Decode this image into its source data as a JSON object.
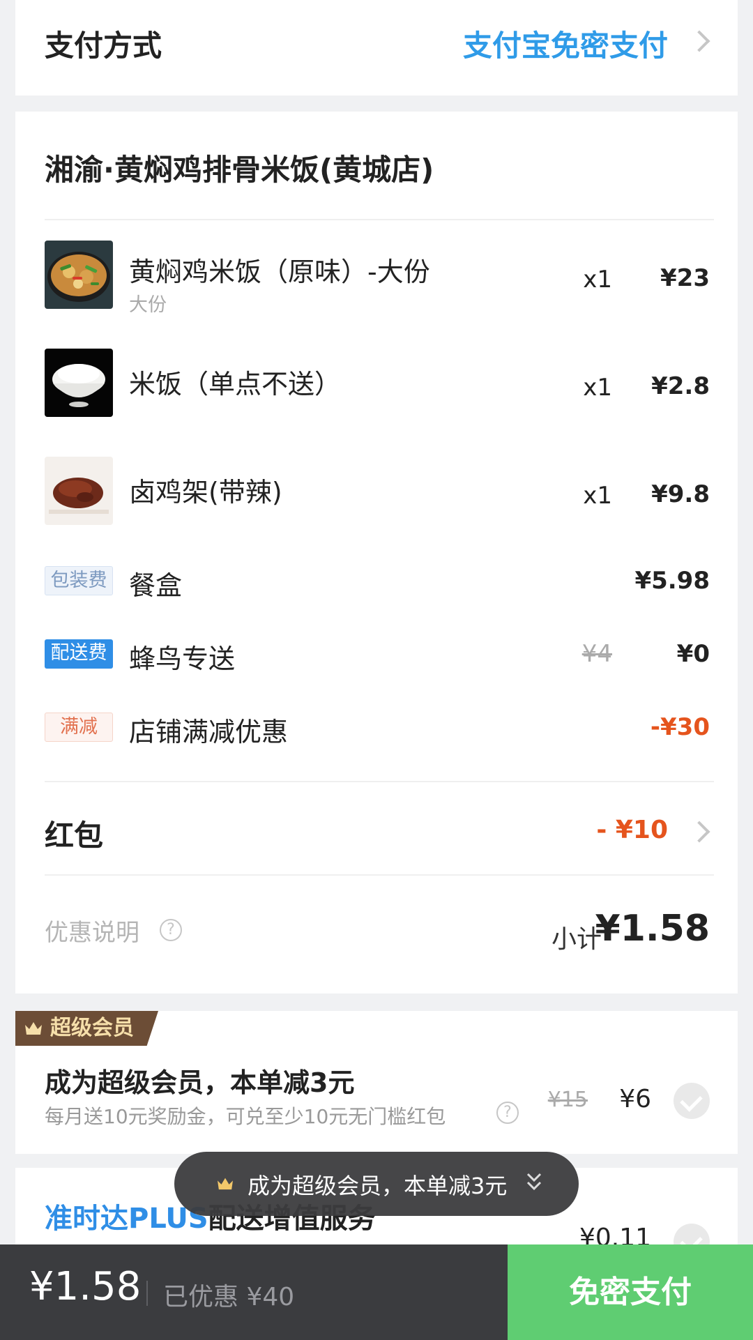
{
  "payment": {
    "title": "支付方式",
    "method": "支付宝免密支付"
  },
  "order": {
    "shop_name": "湘渝·黄焖鸡排骨米饭(黄城店)",
    "items": [
      {
        "name": "黄焖鸡米饭（原味）-大份",
        "spec": "大份",
        "qty": "x1",
        "price": "¥23",
        "image": "braised-chicken-icon"
      },
      {
        "name": "米饭（单点不送）",
        "spec": "",
        "qty": "x1",
        "price": "¥2.8",
        "image": "rice-bowl-icon"
      },
      {
        "name": "卤鸡架(带辣)",
        "spec": "",
        "qty": "x1",
        "price": "¥9.8",
        "image": "braised-chicken-rack-icon"
      }
    ],
    "fees": {
      "packaging": {
        "tag": "包装费",
        "name": "餐盒",
        "price": "¥5.98"
      },
      "delivery": {
        "tag": "配送费",
        "name": "蜂鸟专送",
        "original": "¥4",
        "price": "¥0"
      },
      "discount": {
        "tag": "满减",
        "name": "店铺满减优惠",
        "price": "-¥30"
      }
    },
    "hongbao": {
      "label": "红包",
      "value": "- ¥10"
    },
    "promo_explain": "优惠说明",
    "subtotal": {
      "label": "小计",
      "value": "¥1.58"
    }
  },
  "super_member": {
    "badge": "超级会员",
    "title": "成为超级会员，本单减3元",
    "desc": "每月送10元奖励金，可兑至少10元无门槛红包",
    "original_price": "¥15",
    "price": "¥6"
  },
  "plus_service": {
    "brand": "准时达PLUS",
    "title": "配送增值服务",
    "price": "¥0.11"
  },
  "toast": {
    "text": "成为超级会员，本单减3元"
  },
  "bottom_bar": {
    "total": "¥1.58",
    "discount": "已优惠 ¥40",
    "pay_button": "免密支付"
  },
  "colors": {
    "accent_blue": "#2f9be8",
    "discount_red": "#e5541d",
    "pay_green": "#5fcd72",
    "member_brown": "#6c4d36"
  }
}
